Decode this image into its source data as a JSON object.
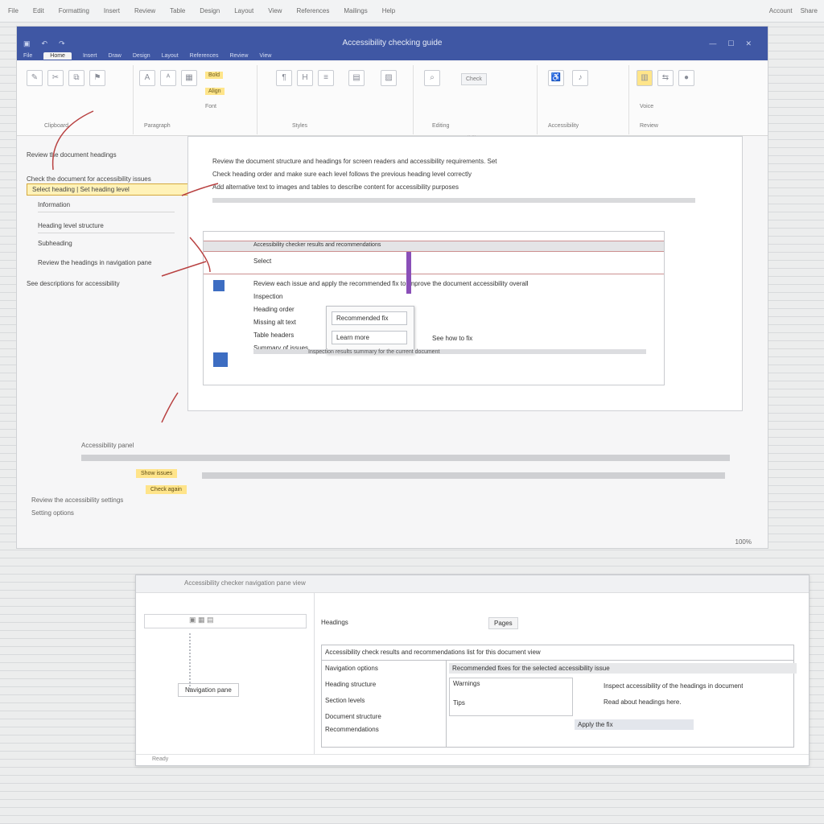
{
  "topbar": {
    "items": [
      "File",
      "Edit",
      "Formatting",
      "Insert",
      "Review",
      "Table",
      "Design",
      "Layout",
      "View",
      "References",
      "Mailings",
      "Help"
    ],
    "right": [
      "Account",
      "Share"
    ]
  },
  "window": {
    "title": "Accessibility checking guide",
    "tabs": [
      "File",
      "Home",
      "Insert",
      "Draw",
      "Design",
      "Layout",
      "References",
      "Review",
      "View"
    ],
    "active_tab": "Home",
    "ribbon": {
      "groups": [
        {
          "label": "Clipboard"
        },
        {
          "label": "Font",
          "highlight": "Bold"
        },
        {
          "label": "Paragraph",
          "highlight": "Align"
        },
        {
          "label": "Styles"
        },
        {
          "label": "Editing"
        },
        {
          "label": "Accessibility",
          "highlight": "Check"
        },
        {
          "label": "Voice"
        },
        {
          "label": "Review"
        }
      ],
      "footer": "Accessibility"
    },
    "left_panel": {
      "heading": "Review the document headings",
      "subheading": "Check the document for accessibility issues",
      "selected": "Select heading | Set heading level",
      "items": [
        "Information",
        "Heading level structure",
        "Subheading"
      ],
      "tip": "Review the headings in navigation pane",
      "tip2": "See descriptions for accessibility"
    },
    "document": {
      "lines": [
        "Review the document structure and headings for screen readers and accessibility requirements. Set",
        "Check heading order and make sure each level follows the previous heading level correctly",
        "Add alternative text to images and tables to describe content for accessibility purposes"
      ],
      "dialog": {
        "header": "Accessibility checker results and recommendations",
        "subtitle": "Select",
        "body": "Review each issue and apply the recommended fix to improve the document accessibility overall",
        "rows": [
          "Inspection",
          "Heading order",
          "Missing alt text",
          "Table headers",
          "Summary of issues"
        ],
        "dropdown": [
          "Recommended fix",
          "Learn more"
        ],
        "footer_note": "See how to fix",
        "footer_line": "Inspection results summary for the current document"
      }
    },
    "bottom": {
      "label": "Accessibility panel",
      "highlight1": "Show issues",
      "highlight2": "Check again",
      "note": "Review the accessibility settings",
      "note2": "Setting options"
    },
    "status": "100%"
  },
  "window2": {
    "title": "Accessibility checker navigation pane view",
    "left": {
      "item": "Navigation pane"
    },
    "right": {
      "heading": "Headings",
      "toolbar": "Pages",
      "table_header": "Accessibility check results and recommendations list for this document view",
      "rows_left": [
        "Navigation options",
        "Heading structure",
        "Section levels",
        "Document structure",
        "Recommendations"
      ],
      "row_header_right": "Recommended fixes for the selected accessibility issue",
      "right_items": [
        "Warnings",
        "Tips"
      ],
      "detail1": "Inspect accessibility of the headings in document",
      "detail2": "Read about headings here.",
      "selection": "Apply the fix"
    },
    "status": "Ready"
  }
}
